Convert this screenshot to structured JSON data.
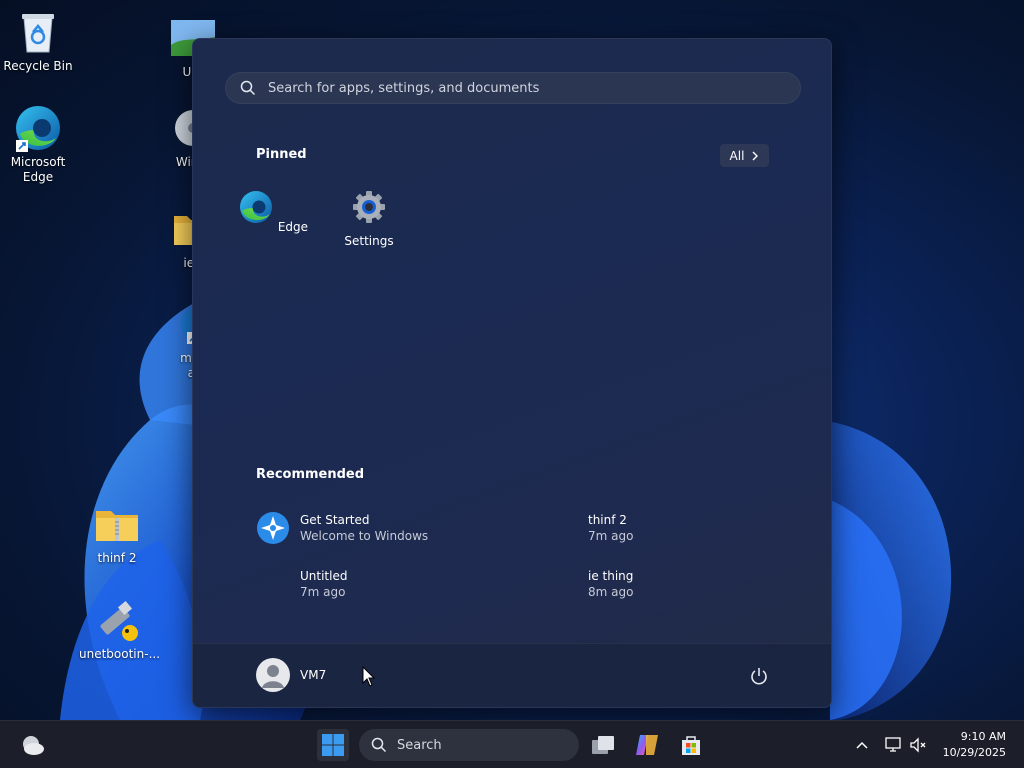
{
  "desktop": {
    "icons": [
      {
        "label": "Recycle Bin"
      },
      {
        "label": "Microsoft Edge"
      },
      {
        "label": "thinf 2"
      },
      {
        "label": "unetbootin-..."
      },
      {
        "label": "Unt"
      },
      {
        "label": "WinCl"
      },
      {
        "label": "ie t"
      },
      {
        "label": "mec"
      },
      {
        "label": "aj"
      }
    ]
  },
  "start_menu": {
    "search_placeholder": "Search for apps, settings, and documents",
    "pinned_title": "Pinned",
    "all_label": "All",
    "pinned": [
      {
        "label": "Edge",
        "icon": "edge-icon"
      },
      {
        "label": "Settings",
        "icon": "gear-icon"
      }
    ],
    "recommended_title": "Recommended",
    "recommended": [
      {
        "title": "Get Started",
        "subtitle": "Welcome to Windows"
      },
      {
        "title": "thinf 2",
        "subtitle": "7m ago"
      },
      {
        "title": "Untitled",
        "subtitle": "7m ago"
      },
      {
        "title": "ie thing",
        "subtitle": "8m ago"
      }
    ],
    "user_name": "VM7"
  },
  "taskbar": {
    "search_label": "Search",
    "time": "9:10 AM",
    "date": "10/29/2025"
  },
  "colors": {
    "accent": "#3a8ee6",
    "start_bg": "#1c2a4d",
    "taskbar_bg": "#1c1f29"
  }
}
